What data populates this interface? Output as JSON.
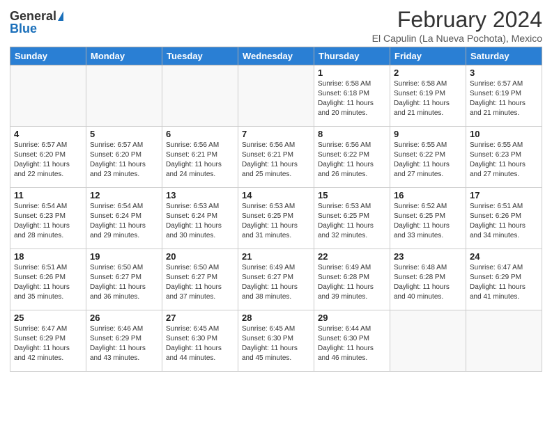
{
  "header": {
    "logo_general": "General",
    "logo_blue": "Blue",
    "month_title": "February 2024",
    "location": "El Capulin (La Nueva Pochota), Mexico"
  },
  "days_of_week": [
    "Sunday",
    "Monday",
    "Tuesday",
    "Wednesday",
    "Thursday",
    "Friday",
    "Saturday"
  ],
  "weeks": [
    [
      {
        "day": "",
        "info": ""
      },
      {
        "day": "",
        "info": ""
      },
      {
        "day": "",
        "info": ""
      },
      {
        "day": "",
        "info": ""
      },
      {
        "day": "1",
        "info": "Sunrise: 6:58 AM\nSunset: 6:18 PM\nDaylight: 11 hours and 20 minutes."
      },
      {
        "day": "2",
        "info": "Sunrise: 6:58 AM\nSunset: 6:19 PM\nDaylight: 11 hours and 21 minutes."
      },
      {
        "day": "3",
        "info": "Sunrise: 6:57 AM\nSunset: 6:19 PM\nDaylight: 11 hours and 21 minutes."
      }
    ],
    [
      {
        "day": "4",
        "info": "Sunrise: 6:57 AM\nSunset: 6:20 PM\nDaylight: 11 hours and 22 minutes."
      },
      {
        "day": "5",
        "info": "Sunrise: 6:57 AM\nSunset: 6:20 PM\nDaylight: 11 hours and 23 minutes."
      },
      {
        "day": "6",
        "info": "Sunrise: 6:56 AM\nSunset: 6:21 PM\nDaylight: 11 hours and 24 minutes."
      },
      {
        "day": "7",
        "info": "Sunrise: 6:56 AM\nSunset: 6:21 PM\nDaylight: 11 hours and 25 minutes."
      },
      {
        "day": "8",
        "info": "Sunrise: 6:56 AM\nSunset: 6:22 PM\nDaylight: 11 hours and 26 minutes."
      },
      {
        "day": "9",
        "info": "Sunrise: 6:55 AM\nSunset: 6:22 PM\nDaylight: 11 hours and 27 minutes."
      },
      {
        "day": "10",
        "info": "Sunrise: 6:55 AM\nSunset: 6:23 PM\nDaylight: 11 hours and 27 minutes."
      }
    ],
    [
      {
        "day": "11",
        "info": "Sunrise: 6:54 AM\nSunset: 6:23 PM\nDaylight: 11 hours and 28 minutes."
      },
      {
        "day": "12",
        "info": "Sunrise: 6:54 AM\nSunset: 6:24 PM\nDaylight: 11 hours and 29 minutes."
      },
      {
        "day": "13",
        "info": "Sunrise: 6:53 AM\nSunset: 6:24 PM\nDaylight: 11 hours and 30 minutes."
      },
      {
        "day": "14",
        "info": "Sunrise: 6:53 AM\nSunset: 6:25 PM\nDaylight: 11 hours and 31 minutes."
      },
      {
        "day": "15",
        "info": "Sunrise: 6:53 AM\nSunset: 6:25 PM\nDaylight: 11 hours and 32 minutes."
      },
      {
        "day": "16",
        "info": "Sunrise: 6:52 AM\nSunset: 6:25 PM\nDaylight: 11 hours and 33 minutes."
      },
      {
        "day": "17",
        "info": "Sunrise: 6:51 AM\nSunset: 6:26 PM\nDaylight: 11 hours and 34 minutes."
      }
    ],
    [
      {
        "day": "18",
        "info": "Sunrise: 6:51 AM\nSunset: 6:26 PM\nDaylight: 11 hours and 35 minutes."
      },
      {
        "day": "19",
        "info": "Sunrise: 6:50 AM\nSunset: 6:27 PM\nDaylight: 11 hours and 36 minutes."
      },
      {
        "day": "20",
        "info": "Sunrise: 6:50 AM\nSunset: 6:27 PM\nDaylight: 11 hours and 37 minutes."
      },
      {
        "day": "21",
        "info": "Sunrise: 6:49 AM\nSunset: 6:27 PM\nDaylight: 11 hours and 38 minutes."
      },
      {
        "day": "22",
        "info": "Sunrise: 6:49 AM\nSunset: 6:28 PM\nDaylight: 11 hours and 39 minutes."
      },
      {
        "day": "23",
        "info": "Sunrise: 6:48 AM\nSunset: 6:28 PM\nDaylight: 11 hours and 40 minutes."
      },
      {
        "day": "24",
        "info": "Sunrise: 6:47 AM\nSunset: 6:29 PM\nDaylight: 11 hours and 41 minutes."
      }
    ],
    [
      {
        "day": "25",
        "info": "Sunrise: 6:47 AM\nSunset: 6:29 PM\nDaylight: 11 hours and 42 minutes."
      },
      {
        "day": "26",
        "info": "Sunrise: 6:46 AM\nSunset: 6:29 PM\nDaylight: 11 hours and 43 minutes."
      },
      {
        "day": "27",
        "info": "Sunrise: 6:45 AM\nSunset: 6:30 PM\nDaylight: 11 hours and 44 minutes."
      },
      {
        "day": "28",
        "info": "Sunrise: 6:45 AM\nSunset: 6:30 PM\nDaylight: 11 hours and 45 minutes."
      },
      {
        "day": "29",
        "info": "Sunrise: 6:44 AM\nSunset: 6:30 PM\nDaylight: 11 hours and 46 minutes."
      },
      {
        "day": "",
        "info": ""
      },
      {
        "day": "",
        "info": ""
      }
    ]
  ]
}
